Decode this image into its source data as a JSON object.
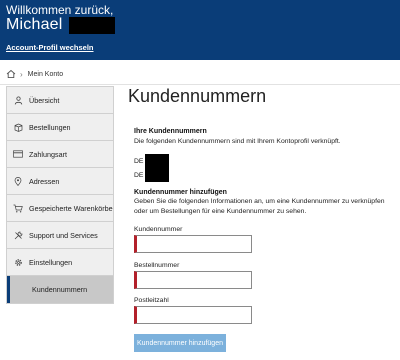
{
  "header": {
    "welcome": "Willkommen zurück,",
    "name": "Michael",
    "switch_link": "Account-Profil wechseln"
  },
  "breadcrumb": {
    "home_icon": "home-icon",
    "current": "Mein Konto"
  },
  "sidebar": {
    "items": [
      {
        "label": "Übersicht",
        "icon": "person-icon"
      },
      {
        "label": "Bestellungen",
        "icon": "box-icon"
      },
      {
        "label": "Zahlungsart",
        "icon": "card-icon"
      },
      {
        "label": "Adressen",
        "icon": "location-icon"
      },
      {
        "label": "Gespeicherte Warenkörbe",
        "icon": "cart-icon"
      },
      {
        "label": "Support und Services",
        "icon": "tools-icon"
      },
      {
        "label": "Einstellungen",
        "icon": "gear-icon"
      },
      {
        "label": "Kundennummern",
        "icon": "",
        "active": true
      }
    ]
  },
  "main": {
    "title": "Kundennummern",
    "your_numbers": {
      "heading": "Ihre Kundennummern",
      "text": "Die folgenden Kundennummern sind mit Ihrem Kontoprofil verknüpft.",
      "entries": [
        "DE",
        "DE"
      ]
    },
    "add": {
      "heading": "Kundennummer hinzufügen",
      "text": "Geben Sie die folgenden Informationen an, um eine Kundennummer zu verknüpfen oder um Bestellungen für eine Kundennummer zu sehen.",
      "fields": [
        {
          "label": "Kundennummer",
          "value": ""
        },
        {
          "label": "Bestellnummer",
          "value": ""
        },
        {
          "label": "Postleitzahl",
          "value": ""
        }
      ],
      "submit": "Kundennummer hinzufügen"
    }
  },
  "colors": {
    "header_bg": "#0a3d78",
    "accent": "#0a3d78",
    "error": "#b3202a",
    "button": "#7cb1dc"
  }
}
